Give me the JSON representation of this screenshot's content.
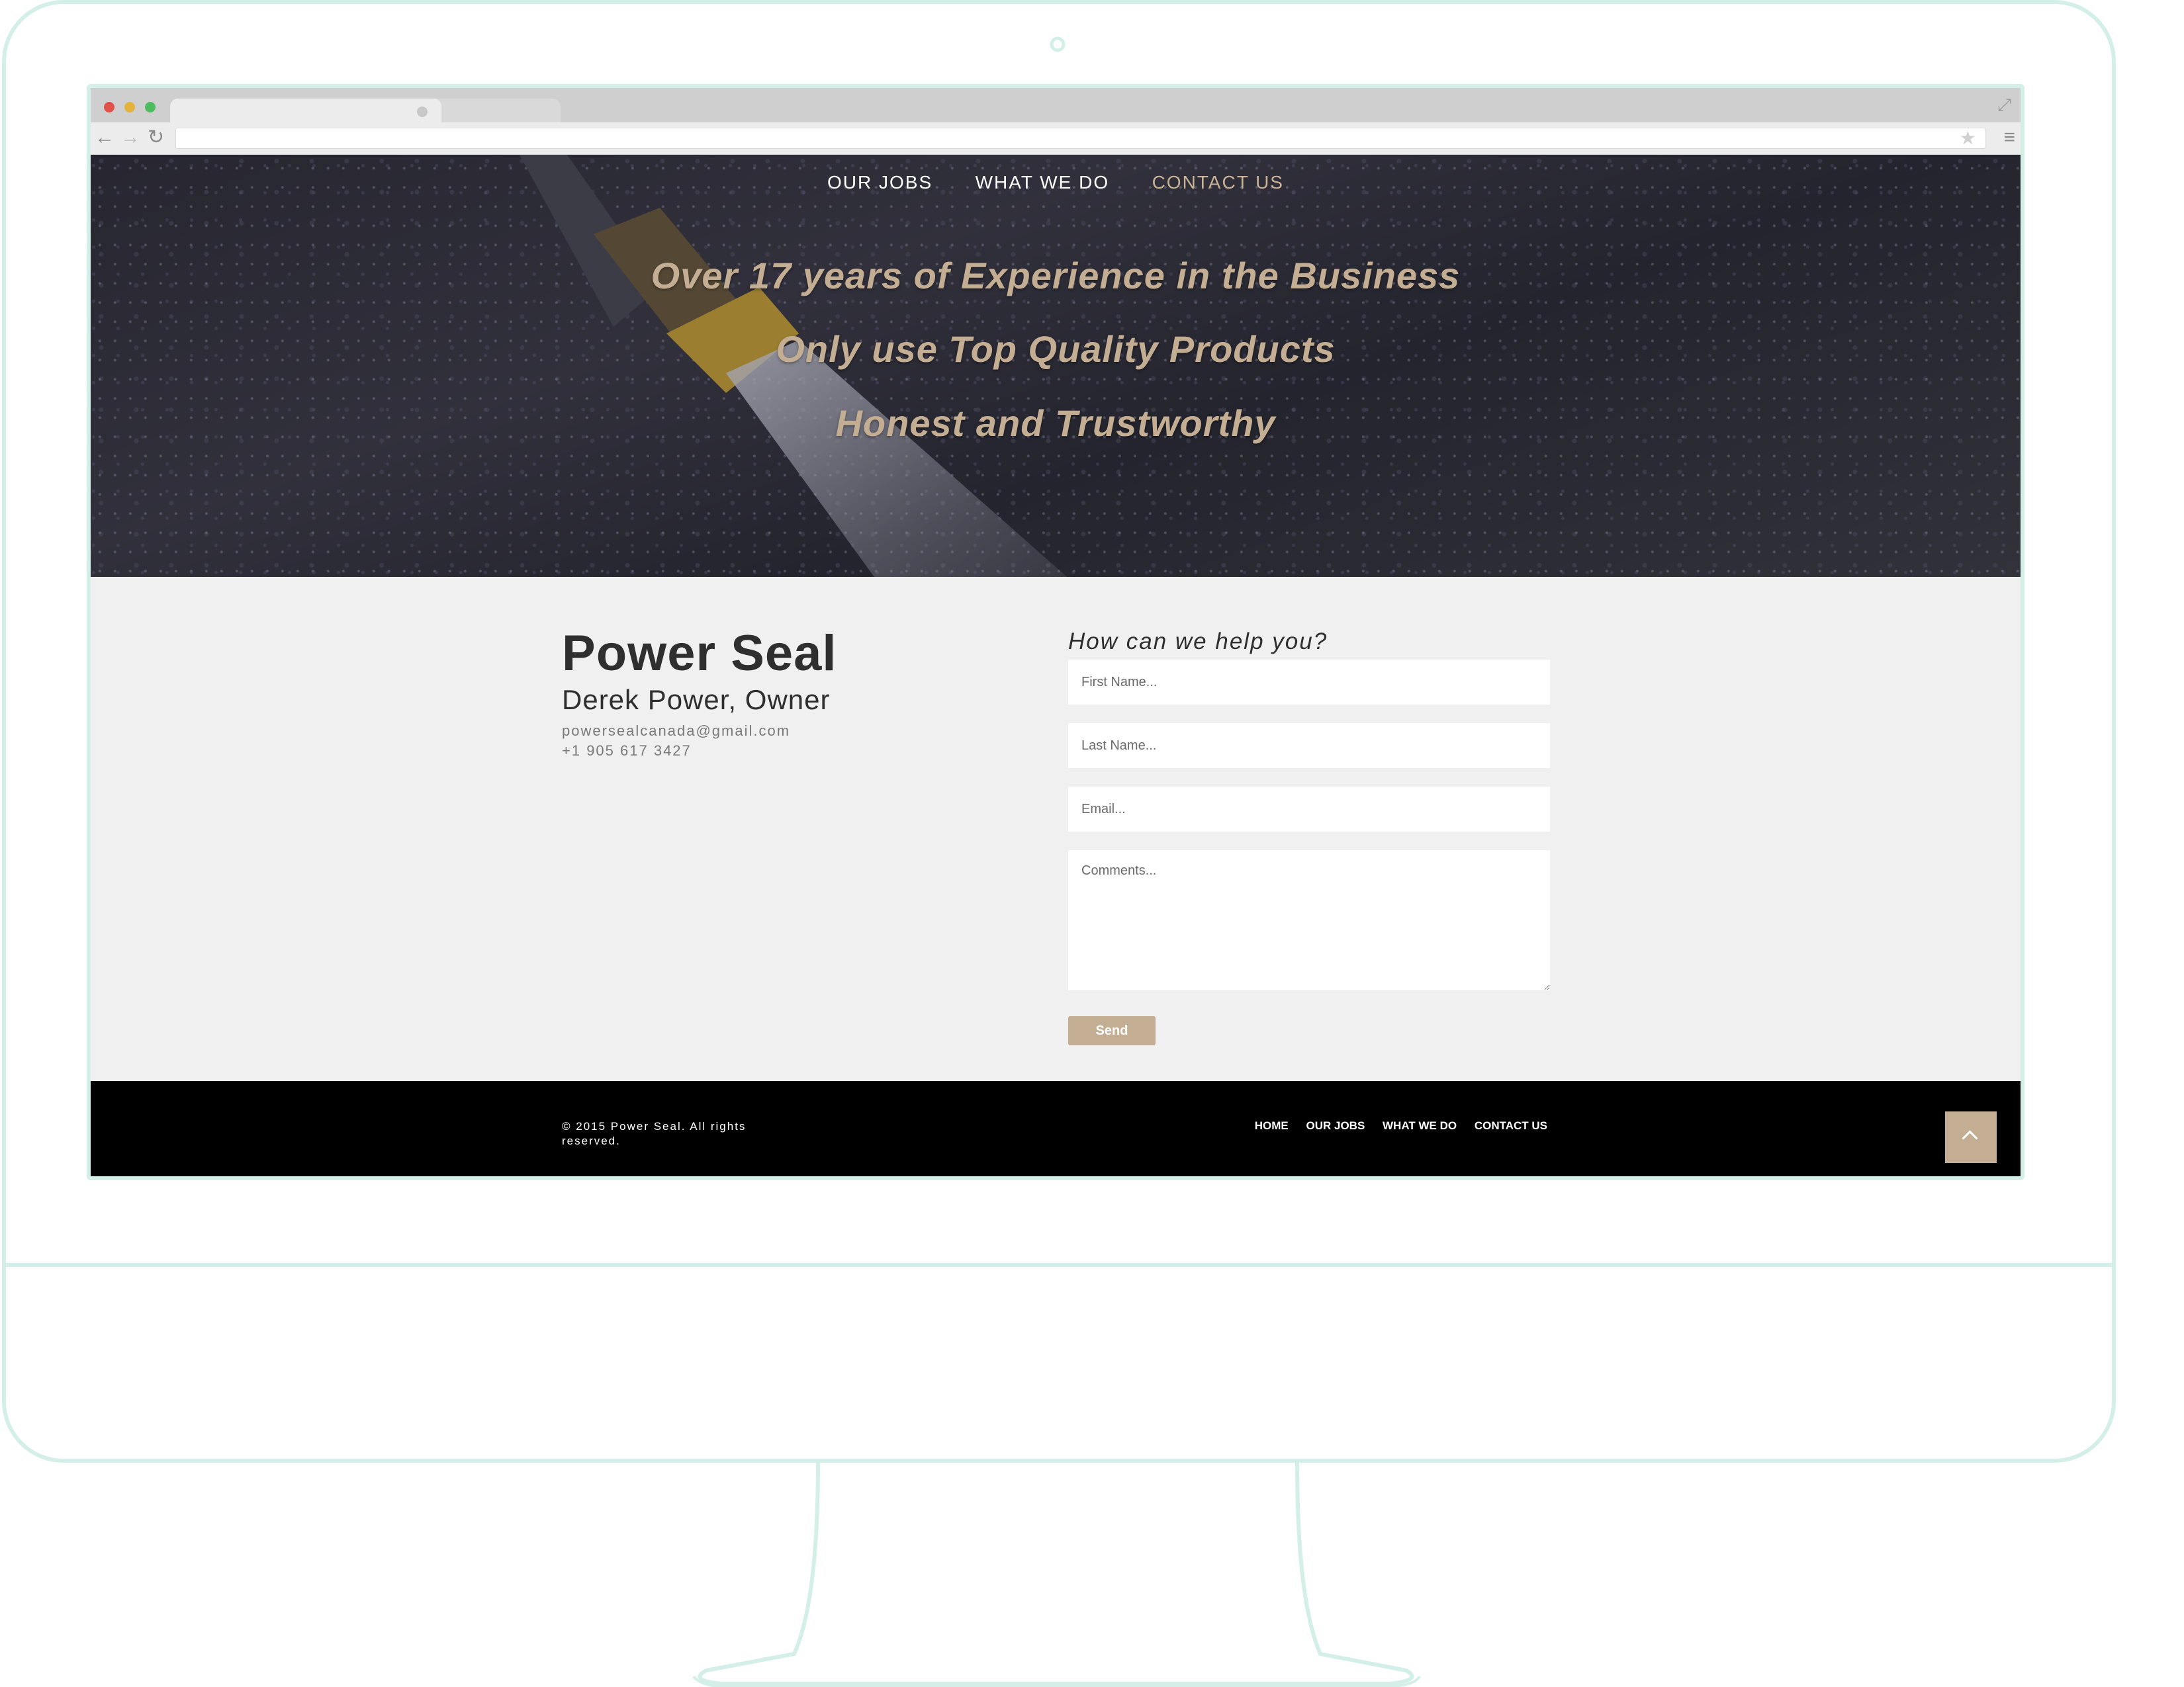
{
  "nav": {
    "items": [
      "OUR JOBS",
      "WHAT WE DO",
      "CONTACT US"
    ]
  },
  "hero": {
    "lines": [
      "Over 17 years of Experience in the Business",
      "Only use Top Quality Products",
      "Honest and Trustworthy"
    ]
  },
  "contact": {
    "company": "Power Seal",
    "owner": "Derek Power, Owner",
    "email": "powersealcanada@gmail.com",
    "phone": "+1 905 617 3427"
  },
  "form": {
    "heading": "How can we help you?",
    "first_name_placeholder": "First Name...",
    "last_name_placeholder": "Last Name...",
    "email_placeholder": "Email...",
    "comments_placeholder": "Comments...",
    "send_label": "Send"
  },
  "footer": {
    "copyright": "© 2015 Power Seal. All rights reserved.",
    "links": [
      "HOME",
      "OUR JOBS",
      "WHAT WE DO",
      "CONTACT US"
    ]
  },
  "colors": {
    "accent": "#c4ae93",
    "frame": "#d3efe7",
    "footer_bg": "#000000",
    "section_bg": "#f0f0f0"
  }
}
